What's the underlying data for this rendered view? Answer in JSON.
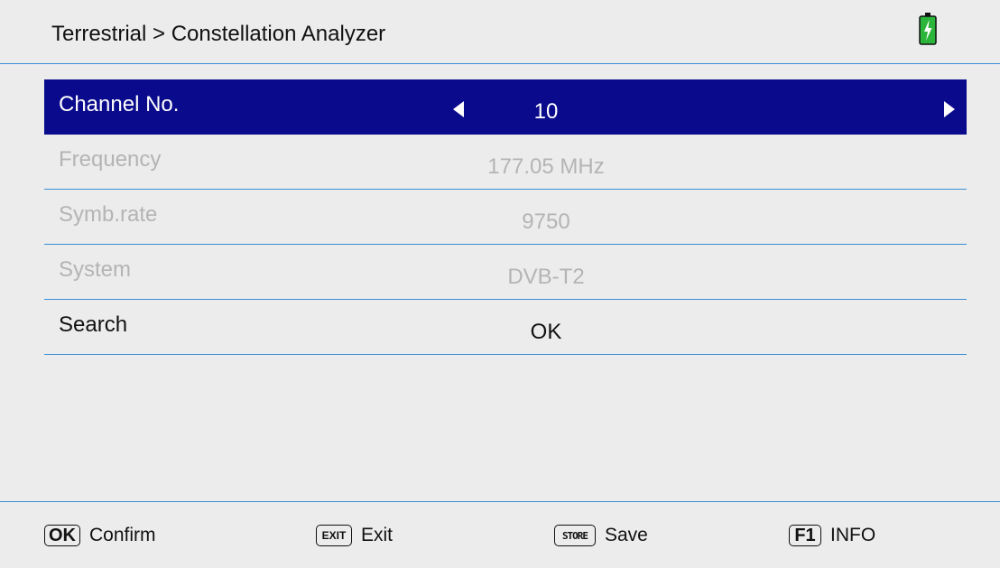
{
  "header": {
    "title": "Terrestrial > Constellation Analyzer",
    "battery_icon": "battery-charging-icon",
    "battery_color": "#2bb53a"
  },
  "menu": {
    "rows": [
      {
        "label": "Channel No.",
        "value": "10",
        "state": "selected"
      },
      {
        "label": "Frequency",
        "value": "177.05 MHz",
        "state": "disabled"
      },
      {
        "label": "Symb.rate",
        "value": "9750",
        "state": "disabled"
      },
      {
        "label": "System",
        "value": "DVB-T2",
        "state": "disabled"
      },
      {
        "label": "Search",
        "value": "OK",
        "state": "enabled"
      }
    ]
  },
  "footer": {
    "items": [
      {
        "key": "OK",
        "label": "Confirm"
      },
      {
        "key": "EXIT",
        "label": "Exit"
      },
      {
        "key": "STORE",
        "label": "Save"
      },
      {
        "key": "F1",
        "label": "INFO"
      }
    ]
  },
  "colors": {
    "background": "#ececec",
    "selection": "#0a0a8c",
    "divider": "#3a8fd6",
    "disabled_text": "#b4b4b4"
  }
}
